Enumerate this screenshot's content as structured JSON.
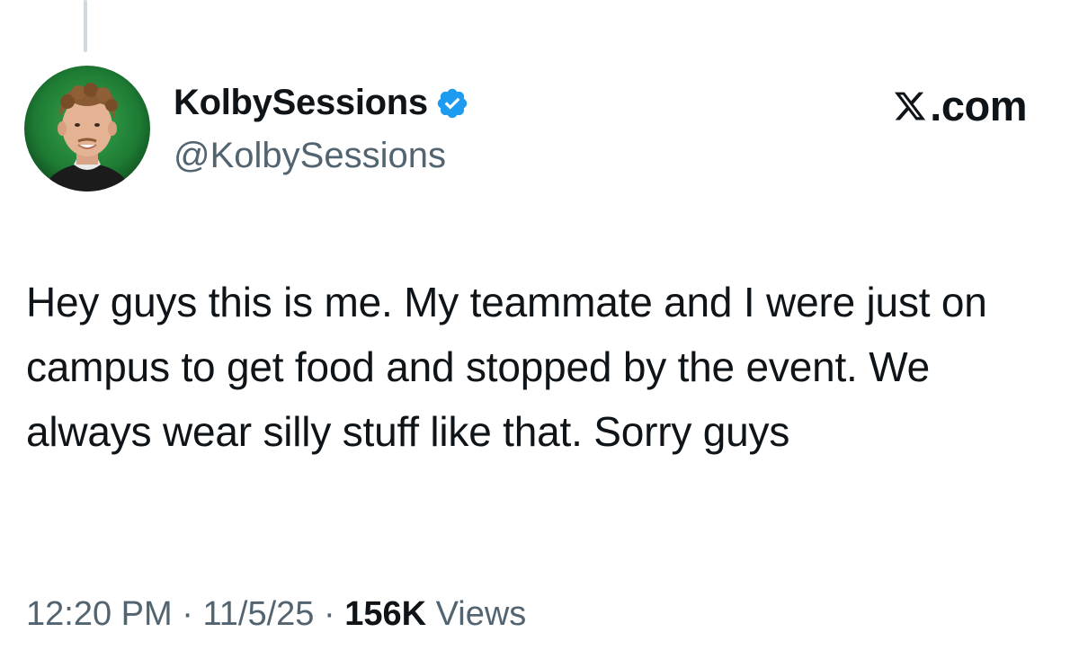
{
  "author": {
    "display_name": "KolbySessions",
    "handle": "@KolbySessions",
    "verified": true,
    "badge_color": "#1d9bf0"
  },
  "brand": {
    "text": ".com",
    "icon": "x-logo-icon"
  },
  "tweet": {
    "text": "Hey guys this is me. My teammate and I were just on campus to get food and stopped by the event. We always wear silly stuff like that. Sorry guys"
  },
  "meta": {
    "time": "12:20 PM",
    "separator": "·",
    "date": "11/5/25",
    "views_count": "156K",
    "views_label": "Views"
  },
  "colors": {
    "text_primary": "#0f1419",
    "text_secondary": "#536471",
    "thread_line": "#cfd9de",
    "avatar_background": "#1f8a3c"
  }
}
